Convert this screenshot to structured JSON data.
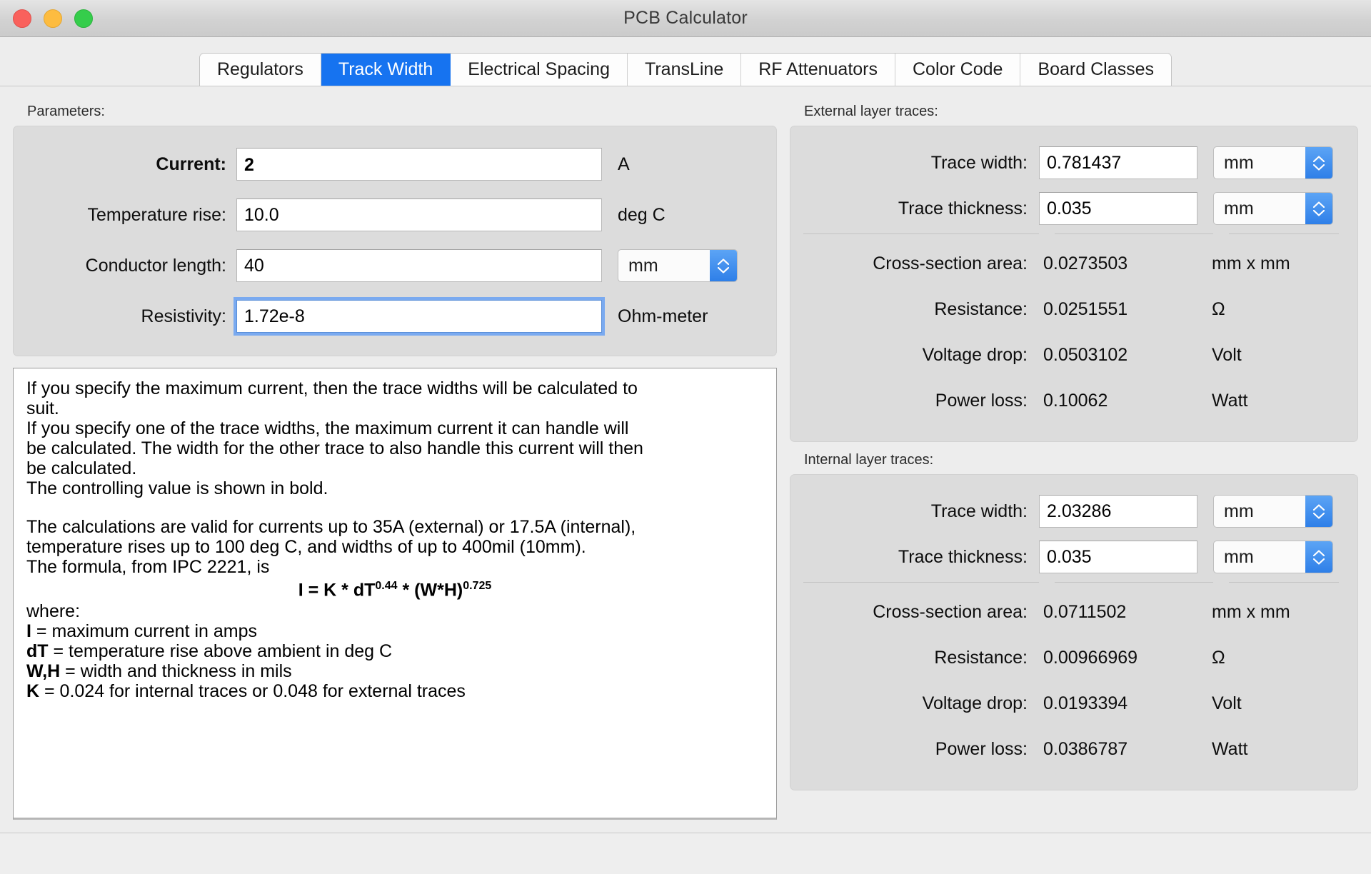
{
  "window": {
    "title": "PCB Calculator",
    "traffic_lights": [
      "close",
      "minimize",
      "zoom"
    ]
  },
  "tabs": [
    {
      "label": "Regulators",
      "active": false
    },
    {
      "label": "Track Width",
      "active": true
    },
    {
      "label": "Electrical Spacing",
      "active": false
    },
    {
      "label": "TransLine",
      "active": false
    },
    {
      "label": "RF Attenuators",
      "active": false
    },
    {
      "label": "Color Code",
      "active": false
    },
    {
      "label": "Board Classes",
      "active": false
    }
  ],
  "parameters": {
    "group_label": "Parameters:",
    "rows": [
      {
        "label": "Current:",
        "value": "2",
        "unit": "A",
        "bold": true,
        "has_stepper": false,
        "focused": false
      },
      {
        "label": "Temperature rise:",
        "value": "10.0",
        "unit": "deg C",
        "bold": false,
        "has_stepper": false,
        "focused": false
      },
      {
        "label": "Conductor length:",
        "value": "40",
        "unit": "",
        "bold": false,
        "has_stepper": true,
        "stepper_value": "mm",
        "focused": false
      },
      {
        "label": "Resistivity:",
        "value": "1.72e-8",
        "unit": "Ohm-meter",
        "bold": false,
        "has_stepper": false,
        "focused": true
      }
    ]
  },
  "help": {
    "para1_line1": "If you specify the maximum current, then the trace widths will be calculated to",
    "para1_line2": "suit.",
    "para2_line1": "If you specify one of the trace widths, the maximum current it can handle will",
    "para2_line2": "be calculated. The width for the other trace to also handle this current will then",
    "para2_line3": "be calculated.",
    "para3": "The controlling value is shown in bold.",
    "para4_line1": "The calculations are valid for currents up to 35A (external) or 17.5A (internal),",
    "para4_line2": "temperature rises up to 100 deg C, and widths of up to 400mil (10mm).",
    "para4_line3": "The formula, from IPC 2221, is",
    "formula": {
      "lhs": "I = K * dT",
      "exp1": "0.44",
      "mid": " * (W*H)",
      "exp2": "0.725"
    },
    "where_label": "where:",
    "where": [
      {
        "sym": "I",
        "def": " = maximum current in amps"
      },
      {
        "sym": "dT",
        "def": " = temperature rise above ambient in deg C"
      },
      {
        "sym": "W,H",
        "def": " = width and thickness in mils"
      },
      {
        "sym": "K",
        "def": " = 0.024 for internal traces or 0.048 for external traces"
      }
    ]
  },
  "external": {
    "group_label": "External layer traces:",
    "inputs": [
      {
        "label": "Trace width:",
        "value": "0.781437",
        "unit": "mm"
      },
      {
        "label": "Trace thickness:",
        "value": "0.035",
        "unit": "mm"
      }
    ],
    "results": [
      {
        "label": "Cross-section area:",
        "value": "0.0273503",
        "unit": "mm x mm"
      },
      {
        "label": "Resistance:",
        "value": "0.0251551",
        "unit": "Ω"
      },
      {
        "label": "Voltage drop:",
        "value": "0.0503102",
        "unit": "Volt"
      },
      {
        "label": "Power loss:",
        "value": "0.10062",
        "unit": "Watt"
      }
    ]
  },
  "internal": {
    "group_label": "Internal layer traces:",
    "inputs": [
      {
        "label": "Trace width:",
        "value": "2.03286",
        "unit": "mm"
      },
      {
        "label": "Trace thickness:",
        "value": "0.035",
        "unit": "mm"
      }
    ],
    "results": [
      {
        "label": "Cross-section area:",
        "value": "0.0711502",
        "unit": "mm x mm"
      },
      {
        "label": "Resistance:",
        "value": "0.00966969",
        "unit": "Ω"
      },
      {
        "label": "Voltage drop:",
        "value": "0.0193394",
        "unit": "Volt"
      },
      {
        "label": "Power loss:",
        "value": "0.0386787",
        "unit": "Watt"
      }
    ]
  },
  "colors": {
    "accent": "#1673f0",
    "stepper_blue": "#2e7fe8",
    "window_bg": "#ededed",
    "group_bg": "#dcdcdc"
  }
}
